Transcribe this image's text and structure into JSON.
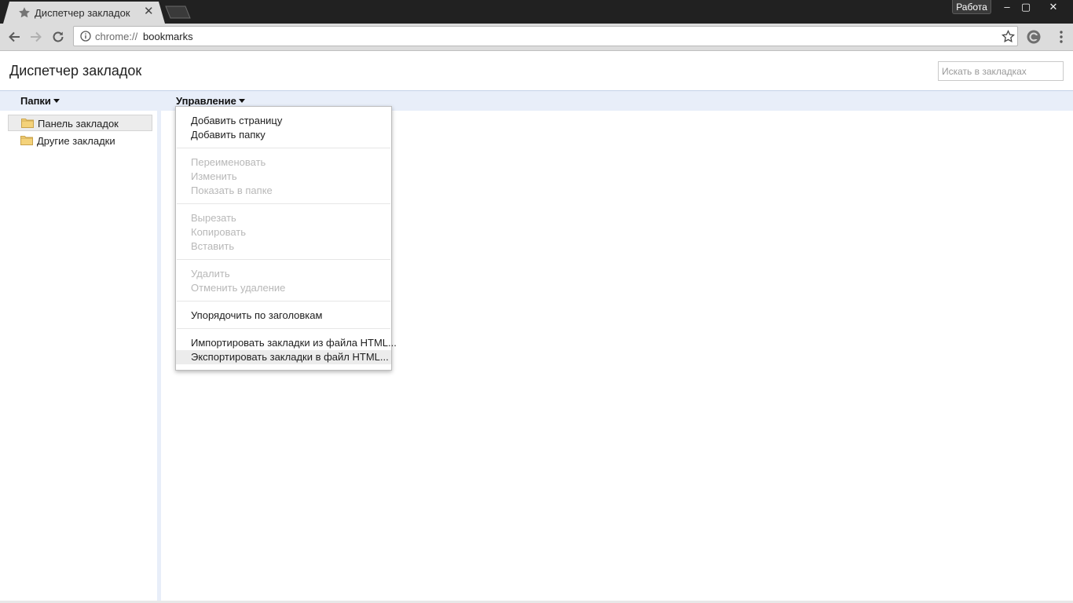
{
  "browser": {
    "tab_title": "Диспетчер закладок",
    "profile_label": "Работа",
    "window_controls": {
      "minimize": "–",
      "maximize": "▢",
      "close": "✕"
    },
    "url_scheme": "chrome://",
    "url_host": "bookmarks",
    "icons": [
      "star-icon",
      "close-icon",
      "back-icon",
      "forward-icon",
      "reload-icon",
      "info-icon",
      "bookmark-star-icon",
      "extension-icon",
      "menu-icon"
    ]
  },
  "page": {
    "title": "Диспетчер закладок",
    "search_placeholder": "Искать в закладках"
  },
  "menubar": {
    "folders_label": "Папки",
    "manage_label": "Управление"
  },
  "folders": [
    {
      "label": "Панель закладок",
      "selected": true
    },
    {
      "label": "Другие закладки",
      "selected": false
    }
  ],
  "dropdown": {
    "items": [
      {
        "label": "Добавить страницу",
        "enabled": true
      },
      {
        "label": "Добавить папку",
        "enabled": true
      },
      {
        "label": "Переименовать",
        "enabled": false
      },
      {
        "label": "Изменить",
        "enabled": false
      },
      {
        "label": "Показать в папке",
        "enabled": false
      },
      {
        "label": "Вырезать",
        "enabled": false
      },
      {
        "label": "Копировать",
        "enabled": false
      },
      {
        "label": "Вставить",
        "enabled": false
      },
      {
        "label": "Удалить",
        "enabled": false
      },
      {
        "label": "Отменить удаление",
        "enabled": false
      },
      {
        "label": "Упорядочить по заголовкам",
        "enabled": true
      },
      {
        "label": "Импортировать закладки из файла HTML...",
        "enabled": true
      },
      {
        "label": "Экспортировать закладки в файл HTML...",
        "enabled": true,
        "highlighted": true
      }
    ]
  },
  "colors": {
    "titlebar": "#212121",
    "toolbar": "#dcdcdc",
    "menubar": "#e8eef9",
    "disabled_text": "#b8b8b8"
  }
}
